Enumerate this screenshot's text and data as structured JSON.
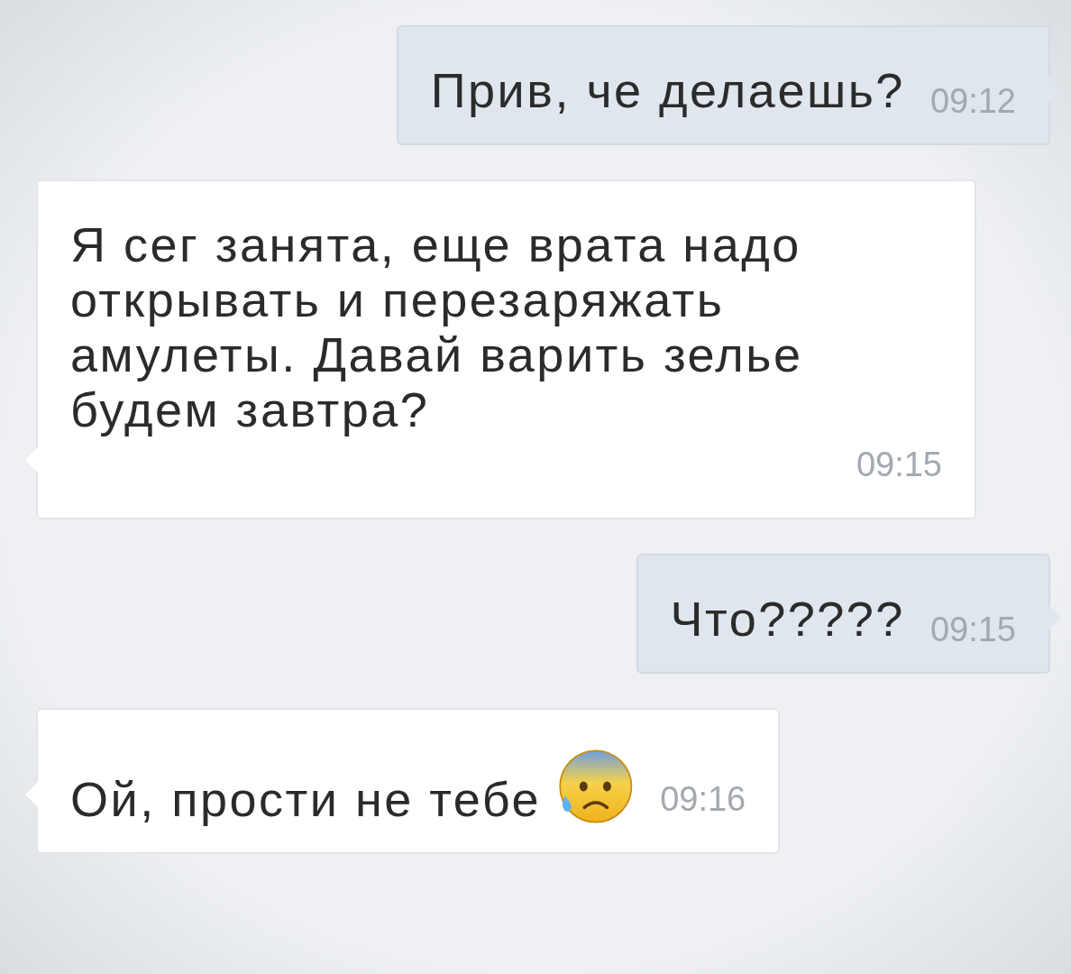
{
  "messages": [
    {
      "kind": "out",
      "text": "Прив, че делаешь?",
      "time": "09:12",
      "emoji": false
    },
    {
      "kind": "in",
      "text": "Я сег занята, еще врата надо открывать и перезаряжать амулеты. Давай варить зелье будем завтра?",
      "time": "09:15",
      "emoji": false
    },
    {
      "kind": "out",
      "text": "Что?????",
      "time": "09:15",
      "emoji": false
    },
    {
      "kind": "in",
      "text": "Ой, прости не тебе",
      "time": "09:16",
      "emoji": true
    }
  ]
}
